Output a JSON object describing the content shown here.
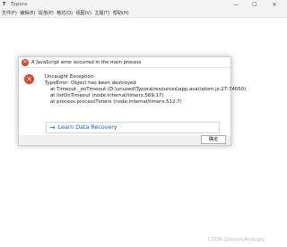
{
  "window": {
    "logo_glyph": "T",
    "title": "Typora",
    "minimize_glyph": "—",
    "maximize_glyph": "☐",
    "close_glyph": "✕"
  },
  "menubar": {
    "items": [
      {
        "label": "文件(F)"
      },
      {
        "label": "编辑(E)"
      },
      {
        "label": "段落(P)"
      },
      {
        "label": "格式(O)"
      },
      {
        "label": "视图(V)"
      },
      {
        "label": "主题(T)"
      },
      {
        "label": "帮助(H)"
      }
    ]
  },
  "dialog": {
    "title_icon_glyph": "✕",
    "title": "A JavaScript error occurred in the main process",
    "error_icon_glyph": "✕",
    "lines": [
      "Uncaught Exception:",
      "TypeError: Object has been destroyed",
      "at Timeout._onTimeout (D:\\unused\\Typora\\resources\\app.asar\\atom.js:27:74050)",
      "at listOnTimeout (node:internal/timers:569:17)",
      "at process.processTimers (node:internal/timers:512:7)"
    ],
    "recovery_arrow_glyph": "→",
    "recovery_link": "Learn Data Recovery",
    "ok_button": "确定"
  },
  "watermark": "CSDN @lonelyAndugly",
  "colors": {
    "error_red": "#d9442b",
    "link_blue": "#0a63c9"
  }
}
